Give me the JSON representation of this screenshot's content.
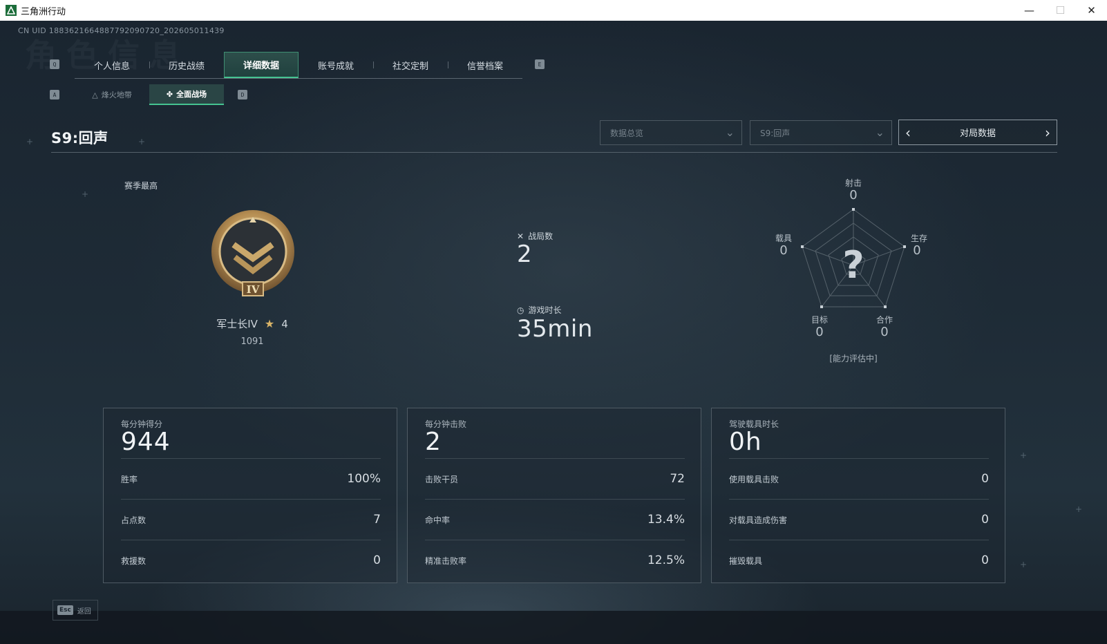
{
  "window": {
    "title": "三角洲行动"
  },
  "header": {
    "uid": "CN UID 1883621664887792090720_202605011439",
    "bg_title": "角色信息"
  },
  "keys": {
    "prev_tab": "Q",
    "next_tab": "E",
    "prev_sub": "A",
    "next_sub": "D"
  },
  "tabs": [
    "个人信息",
    "历史战绩",
    "详细数据",
    "账号成就",
    "社交定制",
    "信誉档案"
  ],
  "subtabs": [
    "烽火地带",
    "全面战场"
  ],
  "season": {
    "title": "S9:回声"
  },
  "filters": {
    "data_view": "数据总览",
    "season_select": "S9:回声",
    "switcher_label": "对局数据"
  },
  "rank": {
    "label": "赛季最高",
    "name": "军士长IV",
    "stars": "4",
    "score": "1091"
  },
  "summary": {
    "matches_label": "战局数",
    "matches_value": "2",
    "playtime_label": "游戏时长",
    "playtime_value": "35min"
  },
  "radar": {
    "shooting": {
      "label": "射击",
      "value": "0"
    },
    "survival": {
      "label": "生存",
      "value": "0"
    },
    "teamwork": {
      "label": "合作",
      "value": "0"
    },
    "objective": {
      "label": "目标",
      "value": "0"
    },
    "vehicle": {
      "label": "载具",
      "value": "0"
    },
    "center_mark": "?",
    "status": "[能力评估中]"
  },
  "cards": [
    {
      "title": "每分钟得分",
      "big": "944",
      "rows": [
        {
          "label": "胜率",
          "value": "100%"
        },
        {
          "label": "占点数",
          "value": "7"
        },
        {
          "label": "救援数",
          "value": "0"
        }
      ]
    },
    {
      "title": "每分钟击败",
      "big": "2",
      "rows": [
        {
          "label": "击败干员",
          "value": "72"
        },
        {
          "label": "命中率",
          "value": "13.4%"
        },
        {
          "label": "精准击败率",
          "value": "12.5%"
        }
      ]
    },
    {
      "title": "驾驶载具时长",
      "big": "0h",
      "rows": [
        {
          "label": "使用载具击败",
          "value": "0"
        },
        {
          "label": "对载具造成伤害",
          "value": "0"
        },
        {
          "label": "摧毁载具",
          "value": "0"
        }
      ]
    }
  ],
  "footer": {
    "esc_key": "Esc",
    "back_label": "返回"
  },
  "colors": {
    "accent": "#45c391",
    "gold": "#d9b468",
    "bg": "#1b2630"
  }
}
